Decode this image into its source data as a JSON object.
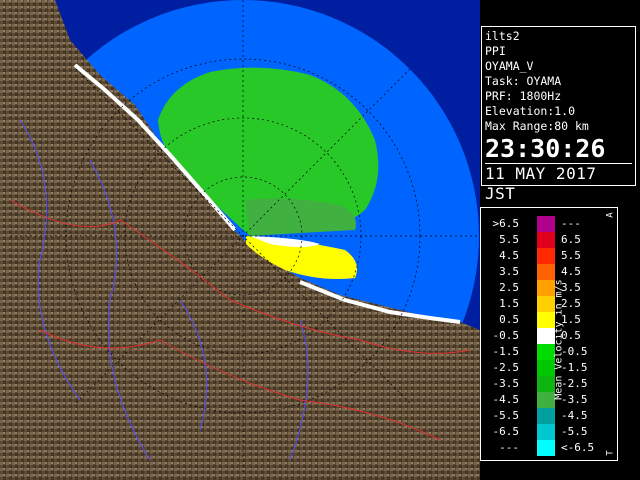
{
  "info": {
    "lines": [
      "ilts2",
      "PPI",
      "OYAMA_V",
      "Task: OYAMA",
      "PRF: 1800Hz",
      "Elevation:1.0",
      "Max Range:80 km"
    ],
    "time": "23:30:26",
    "date": "11 MAY 2017 JST"
  },
  "legend": {
    "title": "Mean Velocity in m/s",
    "top_mark": "A",
    "bottom_mark": "T",
    "rows": [
      {
        "left": ">6.5",
        "right": "---",
        "color": "#b0008c"
      },
      {
        "left": "5.5",
        "right": "6.5",
        "color": "#e0001c"
      },
      {
        "left": "4.5",
        "right": "5.5",
        "color": "#ff2800"
      },
      {
        "left": "3.5",
        "right": "4.5",
        "color": "#ff6000"
      },
      {
        "left": "2.5",
        "right": "3.5",
        "color": "#ffa000"
      },
      {
        "left": "1.5",
        "right": "2.5",
        "color": "#ffd000"
      },
      {
        "left": "0.5",
        "right": "1.5",
        "color": "#ffff00"
      },
      {
        "left": "-0.5",
        "right": "0.5",
        "color": "#ffffff"
      },
      {
        "left": "-1.5",
        "right": "-0.5",
        "color": "#00dc00"
      },
      {
        "left": "-2.5",
        "right": "-1.5",
        "color": "#00c800"
      },
      {
        "left": "-3.5",
        "right": "-2.5",
        "color": "#10b410"
      },
      {
        "left": "-4.5",
        "right": "-3.5",
        "color": "#40b040"
      },
      {
        "left": "-5.5",
        "right": "-4.5",
        "color": "#00a0a0"
      },
      {
        "left": "-6.5",
        "right": "-5.5",
        "color": "#00c8d0"
      },
      {
        "left": "---",
        "right": "<-6.5",
        "color": "#00ffff"
      }
    ]
  },
  "colors": {
    "sea_range": "#0064ff",
    "sea_dark": "#001ea0",
    "land": "#8a7050",
    "green": "#28c828",
    "yellow": "#ffff00",
    "white": "#ffffff"
  }
}
